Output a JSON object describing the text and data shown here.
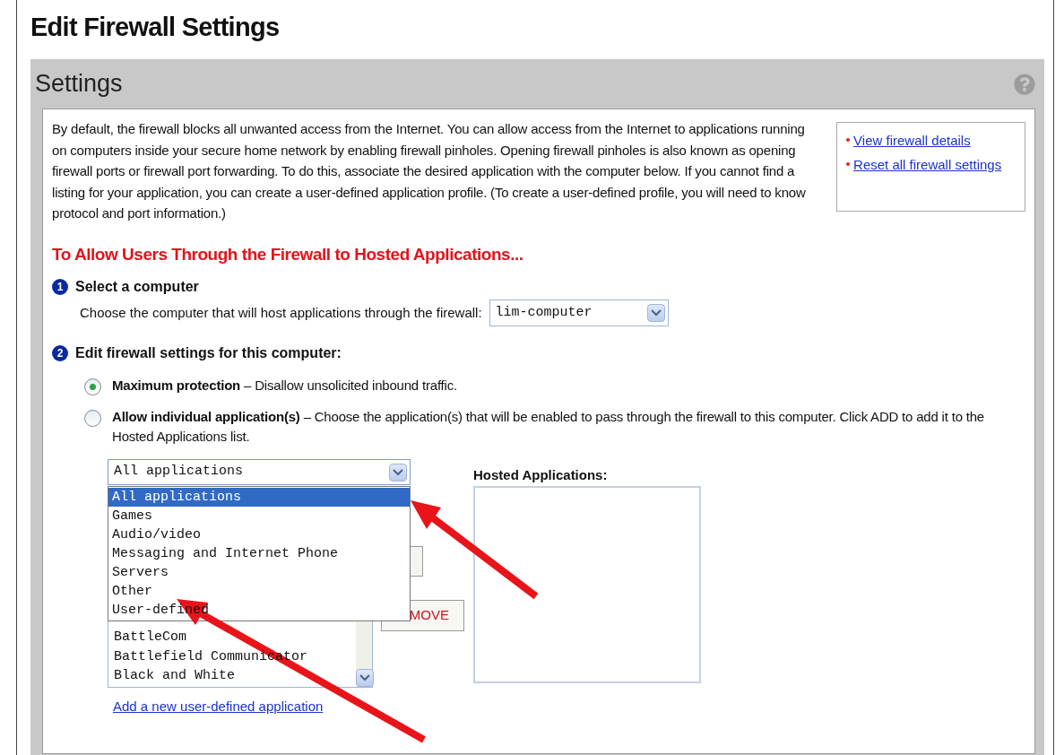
{
  "page_title": "Edit Firewall Settings",
  "panel": {
    "title": "Settings"
  },
  "intro": "By default, the firewall blocks all unwanted access from the Internet. You can allow access from the Internet to applications running on computers inside your secure home network by enabling firewall pinholes. Opening firewall pinholes is also known as opening firewall ports or firewall port forwarding. To do this, associate the desired application with the computer below. If you cannot find a listing for your application, you can create a user-defined application profile. (To create a user-defined profile, you will need to know protocol and port information.)",
  "side_links": [
    "View firewall details",
    "Reset all firewall settings"
  ],
  "section_heading": "To Allow Users Through the Firewall to Hosted Applications...",
  "step_1": {
    "number": "1",
    "title": "Select a computer",
    "label": "Choose the computer that will host applications through the firewall:",
    "value": "lim-computer"
  },
  "step_2": {
    "number": "2",
    "title": "Edit firewall settings for this computer:"
  },
  "options": [
    {
      "label": "Maximum protection",
      "description": "– Disallow unsolicited inbound traffic.",
      "selected": true
    },
    {
      "label": "Allow individual application(s)",
      "description": "– Choose the application(s) that will be enabled to pass through the firewall to this computer. Click ADD to add it to the Hosted Applications list.",
      "selected": false
    }
  ],
  "category_select": {
    "value": "All applications",
    "expanded": true,
    "options": [
      {
        "label": "All applications",
        "selected": true
      },
      {
        "label": "Games",
        "selected": false
      },
      {
        "label": "Audio/video",
        "selected": false
      },
      {
        "label": "Messaging and Internet Phone",
        "selected": false
      },
      {
        "label": "Servers",
        "selected": false
      },
      {
        "label": "Other",
        "selected": false
      },
      {
        "label": "User-defined",
        "selected": false
      }
    ]
  },
  "application_list": [
    "BattleCom",
    "Battlefield Communicator",
    "Black and White"
  ],
  "remove_button": "MOVE",
  "hosted_applications": {
    "label": "Hosted Applications:"
  },
  "add_link": "Add a new user-defined application"
}
